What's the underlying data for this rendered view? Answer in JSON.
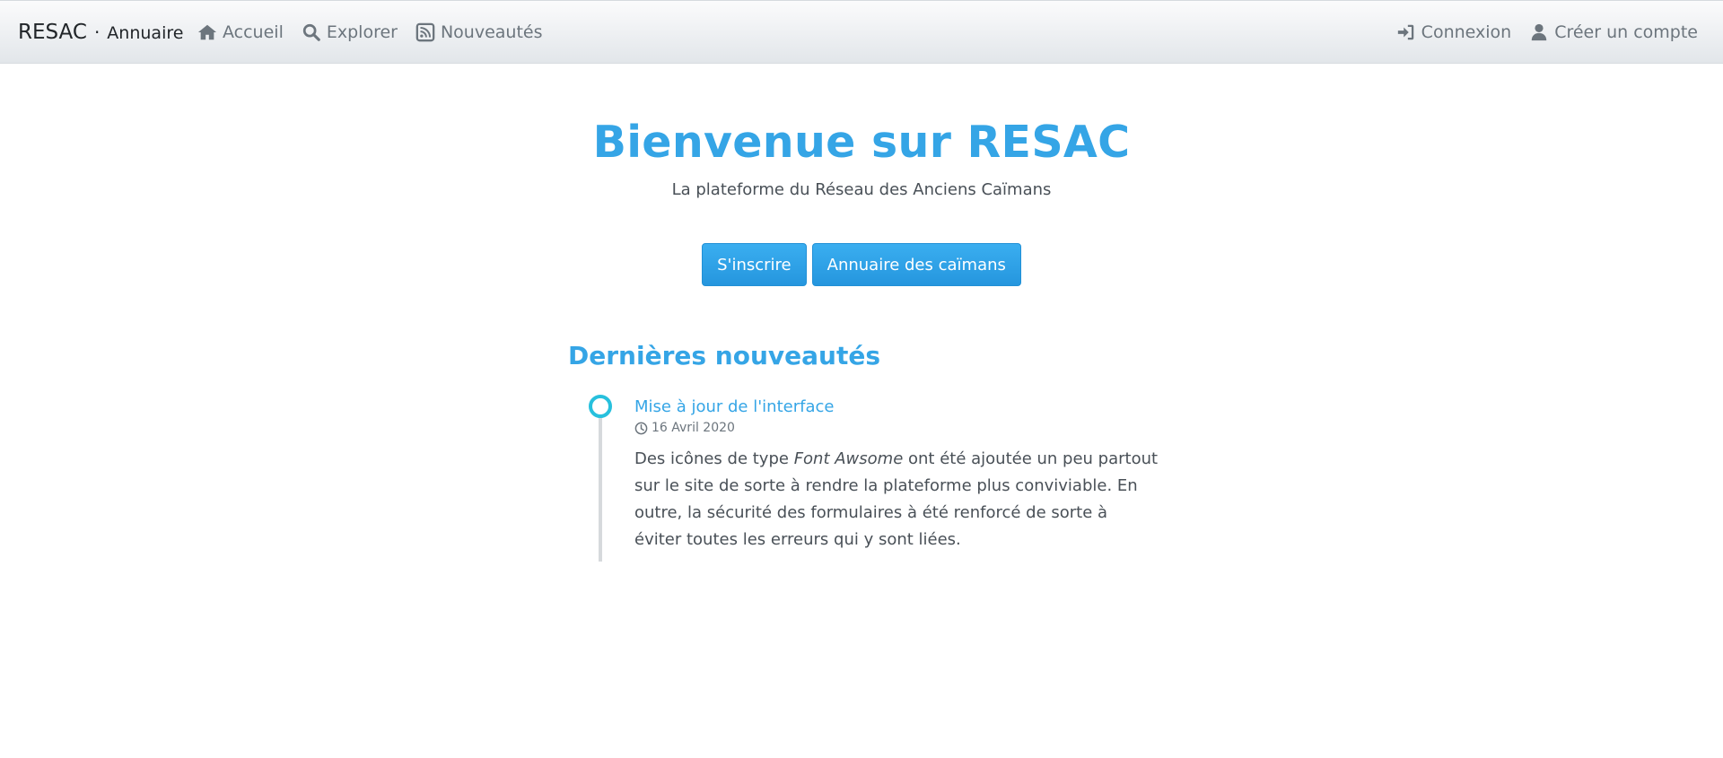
{
  "brand": {
    "main": "RESAC",
    "separator": "·",
    "sub": "Annuaire"
  },
  "nav_left": [
    {
      "icon": "home-icon",
      "label": "Accueil"
    },
    {
      "icon": "search-icon",
      "label": "Explorer"
    },
    {
      "icon": "rss-icon",
      "label": "Nouveautés"
    }
  ],
  "nav_right": [
    {
      "icon": "sign-in-icon",
      "label": "Connexion"
    },
    {
      "icon": "user-icon",
      "label": "Créer un compte"
    }
  ],
  "hero": {
    "title": "Bienvenue sur RESAC",
    "subtitle": "La plateforme du Réseau des Anciens Caïmans",
    "buttons": [
      "S'inscrire",
      "Annuaire des caïmans"
    ]
  },
  "news": {
    "heading": "Dernières nouveautés",
    "items": [
      {
        "title": "Mise à jour de l'interface",
        "date": "16 Avril 2020",
        "text_before": "Des icônes de type ",
        "text_emphasis": "Font Awsome",
        "text_after": " ont été ajoutée un peu partout sur le site de sorte à rendre la plateforme plus conviviable. En outre, la sécurité des formulaires à été renforcé de sorte à éviter toutes les erreurs qui y sont liées."
      }
    ]
  },
  "colors": {
    "accent": "#35a5e6",
    "button": "#2596de",
    "timeline_dot": "#27c0dd",
    "nav_text": "#6c757d"
  }
}
